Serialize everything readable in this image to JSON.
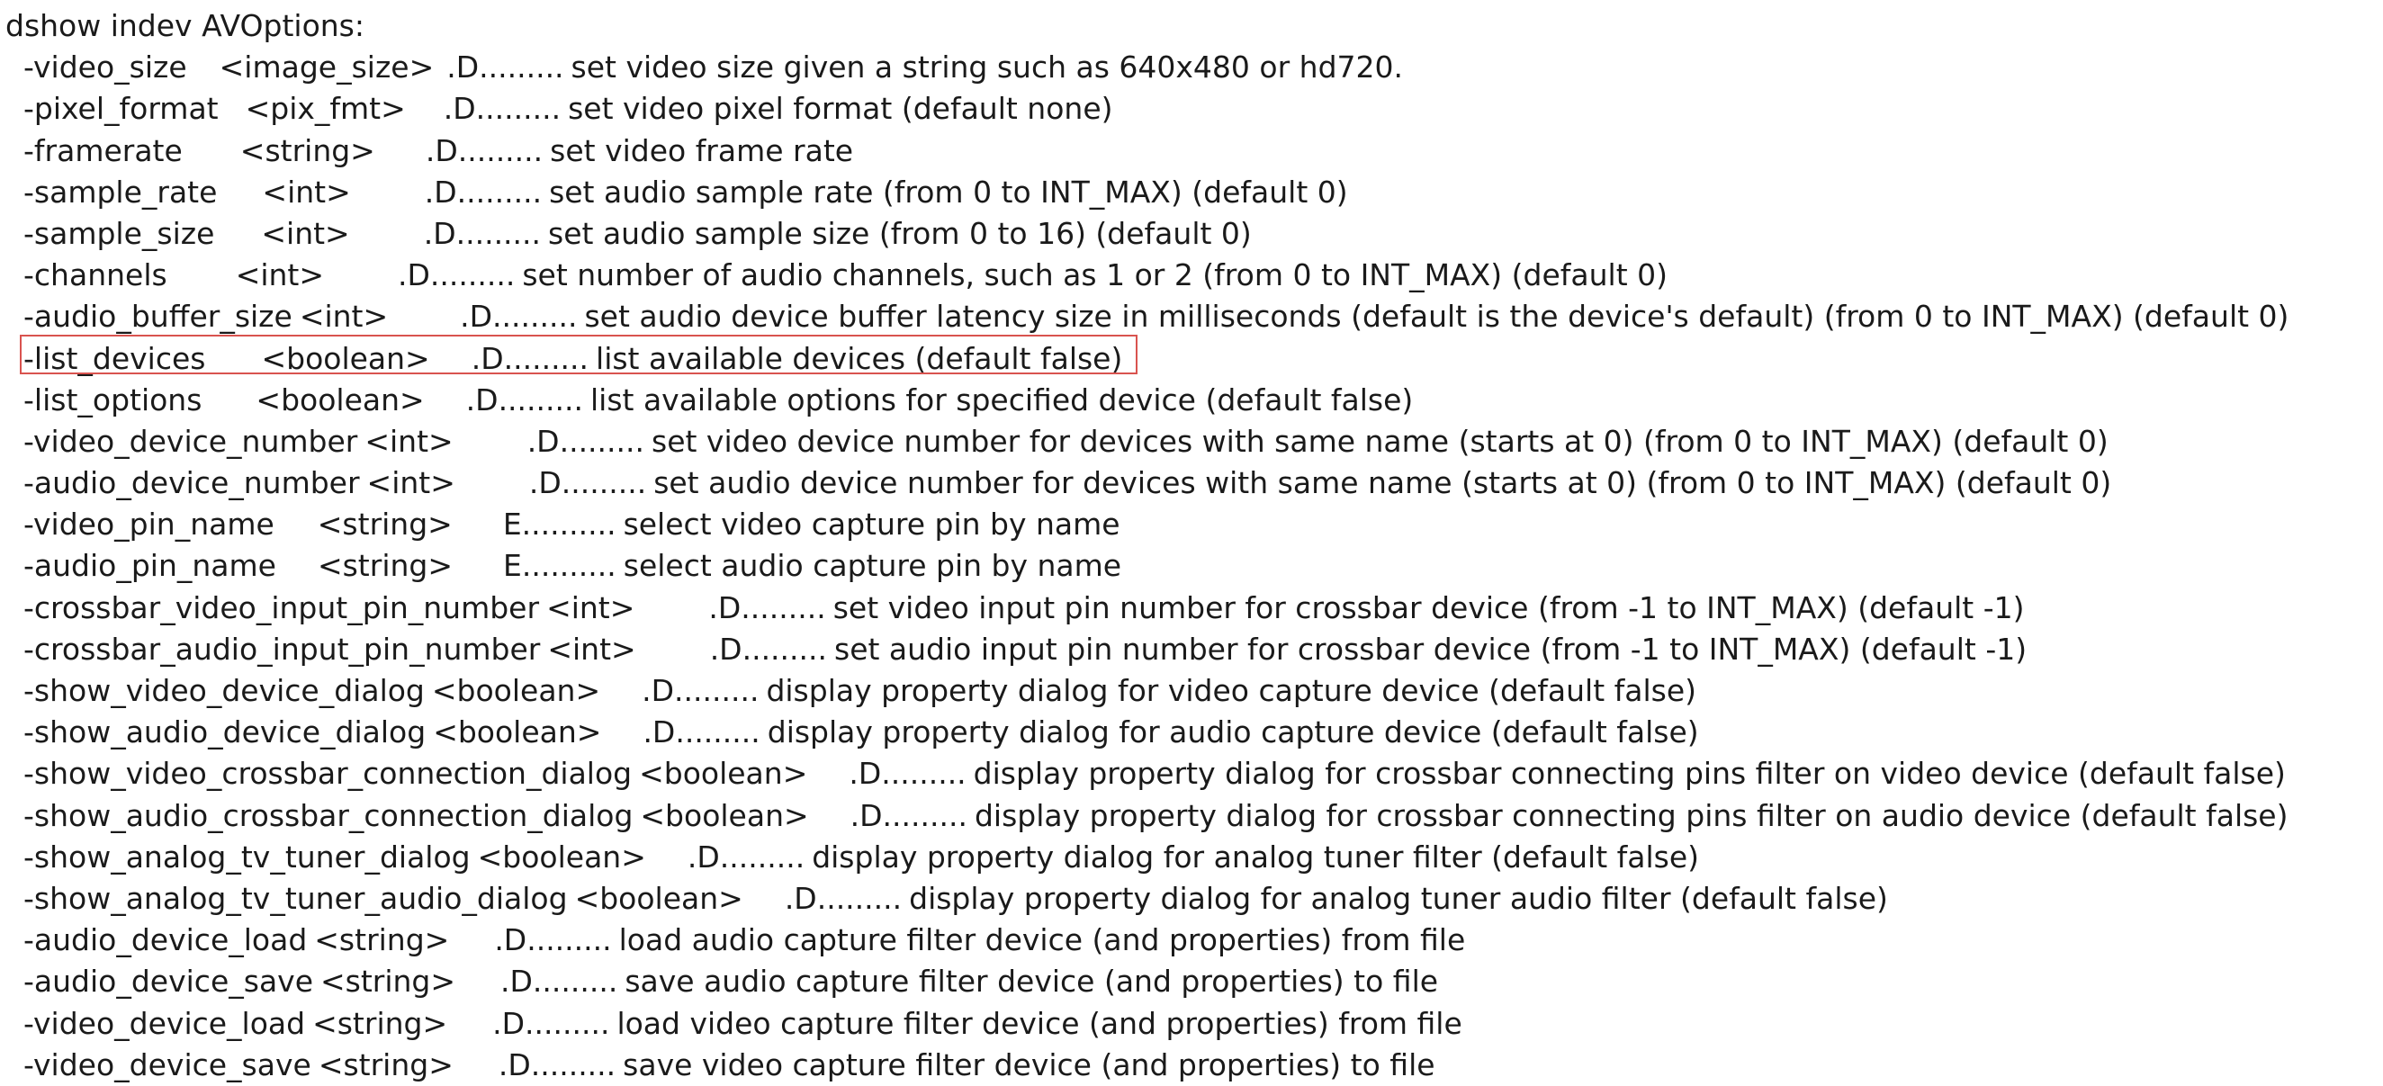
{
  "heading": "dshow indev AVOptions:",
  "highlight_color": "#d9534f",
  "highlighted_option": "-list_devices",
  "options": [
    {
      "name": "-video_size",
      "type": "<image_size>",
      "flags": ".D.........",
      "desc": "set video size given a string such as 640x480 or hd720."
    },
    {
      "name": "-pixel_format",
      "type": "<pix_fmt>",
      "flags": ".D.........",
      "desc": "set video pixel format (default none)"
    },
    {
      "name": "-framerate",
      "type": "<string>",
      "flags": ".D.........",
      "desc": "set video frame rate"
    },
    {
      "name": "-sample_rate",
      "type": "<int>",
      "flags": ".D.........",
      "desc": "set audio sample rate (from 0 to INT_MAX) (default 0)"
    },
    {
      "name": "-sample_size",
      "type": "<int>",
      "flags": ".D.........",
      "desc": "set audio sample size (from 0 to 16) (default 0)"
    },
    {
      "name": "-channels",
      "type": "<int>",
      "flags": ".D.........",
      "desc": "set number of audio channels, such as 1 or 2 (from 0 to INT_MAX) (default 0)"
    },
    {
      "name": "-audio_buffer_size",
      "type": "<int>",
      "flags": ".D.........",
      "desc": "set audio device buffer latency size in milliseconds (default is the device's default) (from 0 to INT_MAX) (default 0)"
    },
    {
      "name": "-list_devices",
      "type": "<boolean>",
      "flags": ".D.........",
      "desc": "list available devices (default false)"
    },
    {
      "name": "-list_options",
      "type": "<boolean>",
      "flags": ".D.........",
      "desc": "list available options for specified device (default false)"
    },
    {
      "name": "-video_device_number",
      "type": "<int>",
      "flags": ".D.........",
      "desc": "set video device number for devices with same name (starts at 0) (from 0 to INT_MAX) (default 0)"
    },
    {
      "name": "-audio_device_number",
      "type": "<int>",
      "flags": ".D.........",
      "desc": "set audio device number for devices with same name (starts at 0) (from 0 to INT_MAX) (default 0)"
    },
    {
      "name": "-video_pin_name",
      "type": "<string>",
      "flags": "E..........",
      "desc": "select video capture pin by name"
    },
    {
      "name": "-audio_pin_name",
      "type": "<string>",
      "flags": "E..........",
      "desc": "select audio capture pin by name"
    },
    {
      "name": "-crossbar_video_input_pin_number",
      "type": "<int>",
      "flags": ".D.........",
      "desc": "set video input pin number for crossbar device (from -1 to INT_MAX) (default -1)"
    },
    {
      "name": "-crossbar_audio_input_pin_number",
      "type": "<int>",
      "flags": ".D.........",
      "desc": "set audio input pin number for crossbar device (from -1 to INT_MAX) (default -1)"
    },
    {
      "name": "-show_video_device_dialog",
      "type": "<boolean>",
      "flags": ".D.........",
      "desc": "display property dialog for video capture device (default false)"
    },
    {
      "name": "-show_audio_device_dialog",
      "type": "<boolean>",
      "flags": ".D.........",
      "desc": "display property dialog for audio capture device (default false)"
    },
    {
      "name": "-show_video_crossbar_connection_dialog",
      "type": "<boolean>",
      "flags": ".D.........",
      "desc": "display property dialog for crossbar connecting pins filter on video device (default false)"
    },
    {
      "name": "-show_audio_crossbar_connection_dialog",
      "type": "<boolean>",
      "flags": ".D.........",
      "desc": "display property dialog for crossbar connecting pins filter on audio device (default false)"
    },
    {
      "name": "-show_analog_tv_tuner_dialog",
      "type": "<boolean>",
      "flags": ".D.........",
      "desc": "display property dialog for analog tuner filter (default false)"
    },
    {
      "name": "-show_analog_tv_tuner_audio_dialog",
      "type": "<boolean>",
      "flags": ".D.........",
      "desc": "display property dialog for analog tuner audio filter (default false)"
    },
    {
      "name": "-audio_device_load",
      "type": "<string>",
      "flags": ".D.........",
      "desc": "load audio capture filter device (and properties) from file"
    },
    {
      "name": "-audio_device_save",
      "type": "<string>",
      "flags": ".D.........",
      "desc": "save audio capture filter device (and properties) to file"
    },
    {
      "name": "-video_device_load",
      "type": "<string>",
      "flags": ".D.........",
      "desc": "load video capture filter device (and properties) from file"
    },
    {
      "name": "-video_device_save",
      "type": "<string>",
      "flags": ".D.........",
      "desc": "save video capture filter device (and properties) to file"
    }
  ]
}
